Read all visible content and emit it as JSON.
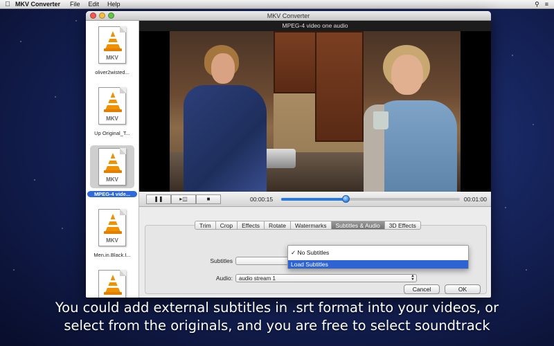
{
  "menubar": {
    "app_name": "MKV Converter",
    "items": [
      "File",
      "Edit",
      "Help"
    ]
  },
  "window": {
    "title": "MKV Converter"
  },
  "files": [
    {
      "name": "oliver2wisted...",
      "icon_label": "MKV"
    },
    {
      "name": "Up Original_T...",
      "icon_label": "MKV"
    },
    {
      "name": "MPEG-4 vide...",
      "icon_label": "MKV",
      "selected": true
    },
    {
      "name": "Men.in.Black.I...",
      "icon_label": "MKV"
    },
    {
      "name": "",
      "icon_label": ""
    }
  ],
  "player": {
    "video_title": "MPEG-4 video one audio",
    "current_time": "00:00:15",
    "total_time": "00:01:00",
    "progress": 0.36
  },
  "tabs": [
    {
      "label": "Trim"
    },
    {
      "label": "Crop"
    },
    {
      "label": "Effects"
    },
    {
      "label": "Rotate"
    },
    {
      "label": "Watermarks"
    },
    {
      "label": "Subtitles & Audio",
      "active": true
    },
    {
      "label": "3D Effects"
    }
  ],
  "subtitles": {
    "label": "Subtitles",
    "options": [
      {
        "label": "✓ No Subtitles"
      },
      {
        "label": "Load Subtitles",
        "highlighted": true
      }
    ]
  },
  "audio": {
    "label": "Audio",
    "value": "audio stream 1"
  },
  "buttons": {
    "cancel": "Cancel",
    "ok": "OK"
  },
  "caption": {
    "line1": "You could add external subtitles in .srt format into your videos, or",
    "line2": "select from the originals, and you are free to select soundtrack"
  },
  "colors": {
    "accent": "#2f6ad8",
    "progress": "#2a78d8",
    "background": "#16245c"
  }
}
